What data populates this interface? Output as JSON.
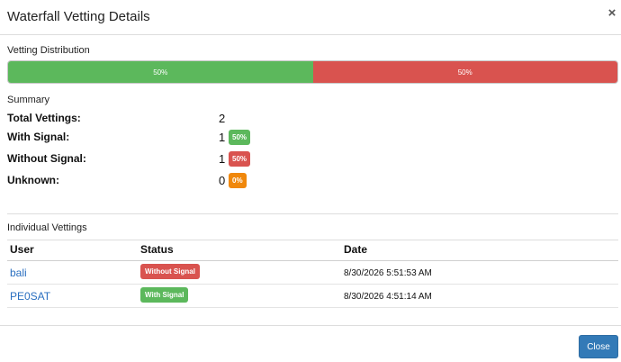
{
  "modal": {
    "title": "Waterfall Vetting Details",
    "close_icon": "×"
  },
  "distribution": {
    "title": "Vetting Distribution",
    "segments": [
      {
        "label": "50%",
        "value": 0.5,
        "color": "#5cb85c"
      },
      {
        "label": "50%",
        "value": 0.5,
        "color": "#d9534f"
      }
    ]
  },
  "summary": {
    "title": "Summary",
    "rows": [
      {
        "label": "Total Vettings:",
        "value": "2",
        "badge": ""
      },
      {
        "label": "With Signal:",
        "value": "1",
        "badge": "50%"
      },
      {
        "label": "Without Signal:",
        "value": "1",
        "badge": "50%"
      },
      {
        "label": "Unknown:",
        "value": "0",
        "badge": "0%"
      }
    ]
  },
  "individual": {
    "title": "Individual Vettings",
    "columns": [
      "User",
      "Status",
      "Date"
    ],
    "rows": [
      {
        "user": "bali",
        "status": "Without Signal",
        "date": "8/30/2026 5:51:53 AM"
      },
      {
        "user": "PE0SAT",
        "status": "With Signal",
        "date": "8/30/2026 4:51:14 AM"
      }
    ]
  },
  "footer": {
    "close_label": "Close"
  },
  "colors": {
    "green": "#5cb85c",
    "red": "#d9534f",
    "orange": "#f0880c",
    "primary": "#337ab7",
    "link": "#2a6fc0"
  }
}
